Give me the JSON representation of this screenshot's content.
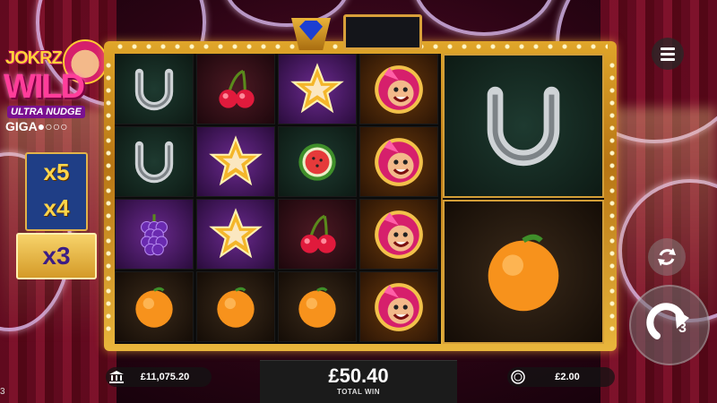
{
  "logo": {
    "line1": "JOKRZ",
    "line2": "WILD",
    "line3": "ULTRA NUDGE",
    "line4": "GIGA●○○○"
  },
  "multipliers": {
    "inactive": [
      "x5",
      "x4"
    ],
    "active": "x3"
  },
  "reels": [
    [
      "horseshoe",
      "horseshoe",
      "grapes",
      "orange"
    ],
    [
      "cherry",
      "star",
      "star",
      "orange"
    ],
    [
      "star",
      "watermelon",
      "cherry",
      "orange"
    ],
    [
      "joker-wild",
      "joker-wild",
      "joker-wild",
      "joker-wild"
    ]
  ],
  "big_reel": [
    "horseshoe",
    "orange"
  ],
  "controls": {
    "spin_count": "3"
  },
  "bottom_bar": {
    "balance": "£11,075.20",
    "total_win_amount": "£50.40",
    "total_win_label": "TOTAL WIN",
    "bet": "£2.00"
  },
  "corner_text": "3",
  "colors": {
    "frame_gold": "#d9a03a",
    "multiplier_blue": "#1f3e86",
    "multiplier_gold": "#ffd54a",
    "background": "#2b0414"
  }
}
